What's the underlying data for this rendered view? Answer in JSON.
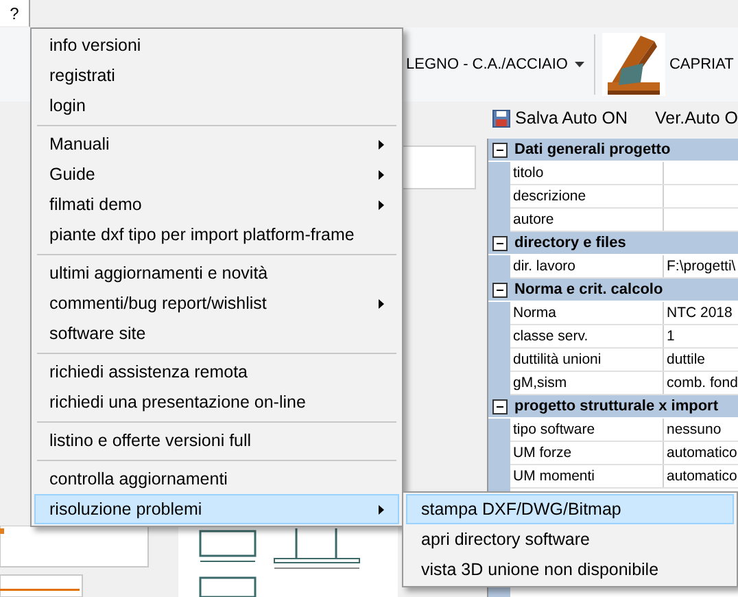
{
  "menu_bar": [
    {
      "label": "?",
      "selected": true
    }
  ],
  "ribbon": {
    "dropdown": "LEGNO - C.A./ACCIAIO",
    "tool": "CAPRIAT"
  },
  "toolbar": [
    {
      "label": "Salva Auto ON",
      "kind": "save"
    },
    {
      "label": "Ver.Auto O",
      "kind": "text"
    }
  ],
  "property_grid": [
    {
      "title": "Dati generali progetto",
      "expanded": true,
      "rows": [
        {
          "name": "titolo"
        },
        {
          "name": "descrizione"
        },
        {
          "name": "autore"
        }
      ]
    },
    {
      "title": "directory e files",
      "expanded": true,
      "rows": [
        {
          "name": "dir. lavoro",
          "value": "F:\\progetti\\"
        }
      ]
    },
    {
      "title": "Norma e crit. calcolo",
      "expanded": true,
      "rows": [
        {
          "name": "Norma",
          "value": "NTC 2018"
        },
        {
          "name": "classe serv.",
          "value": "1"
        },
        {
          "name": "duttilità unioni",
          "value": "duttile"
        },
        {
          "name": "gM,sism",
          "value": "comb. fond"
        }
      ]
    },
    {
      "title": "progetto strutturale x import",
      "expanded": true,
      "rows": [
        {
          "name": "tipo software",
          "value": "nessuno"
        },
        {
          "name": "UM forze",
          "value": "automatico"
        },
        {
          "name": "UM momenti",
          "value": "automatico"
        }
      ]
    }
  ],
  "help_menu": [
    [
      {
        "label": "info versioni",
        "submenu": false,
        "selected": false
      },
      {
        "label": "registrati",
        "submenu": false,
        "selected": false
      },
      {
        "label": "login",
        "submenu": false,
        "selected": false
      }
    ],
    [
      {
        "label": "Manuali",
        "submenu": true,
        "selected": false
      },
      {
        "label": "Guide",
        "submenu": true,
        "selected": false
      },
      {
        "label": "filmati demo",
        "submenu": true,
        "selected": false
      },
      {
        "label": "piante dxf tipo per import platform-frame",
        "submenu": false,
        "selected": false
      }
    ],
    [
      {
        "label": "ultimi aggiornamenti e novità",
        "submenu": false,
        "selected": false
      },
      {
        "label": "commenti/bug report/wishlist",
        "submenu": true,
        "selected": false
      },
      {
        "label": "software site",
        "submenu": false,
        "selected": false
      }
    ],
    [
      {
        "label": "richiedi assistenza remota",
        "submenu": false,
        "selected": false
      },
      {
        "label": "richiedi una presentazione on-line",
        "submenu": false,
        "selected": false
      }
    ],
    [
      {
        "label": "listino e offerte versioni full",
        "submenu": false,
        "selected": false
      }
    ],
    [
      {
        "label": "controlla aggiornamenti",
        "submenu": false,
        "selected": false
      },
      {
        "label": "risoluzione problemi",
        "submenu": true,
        "selected": true
      }
    ]
  ],
  "submenu": [
    {
      "label": "stampa DXF/DWG/Bitmap",
      "selected": true
    },
    {
      "label": "apri directory software",
      "selected": false
    },
    {
      "label": "vista 3D unione non disponibile",
      "selected": false
    }
  ]
}
